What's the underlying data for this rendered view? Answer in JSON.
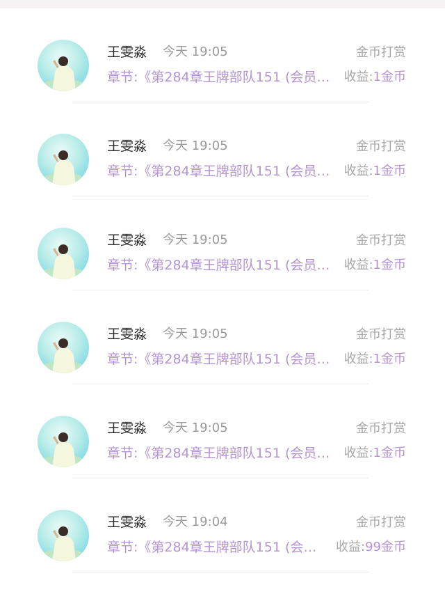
{
  "records": [
    {
      "name": "王雯淼",
      "time": "今天 19:05",
      "type": "金币打赏",
      "chapter": "章节:《第284章王牌部队151 (会员…",
      "income_label": "收益:",
      "income_value": "1金币"
    },
    {
      "name": "王雯淼",
      "time": "今天 19:05",
      "type": "金币打赏",
      "chapter": "章节:《第284章王牌部队151 (会员…",
      "income_label": "收益:",
      "income_value": "1金币"
    },
    {
      "name": "王雯淼",
      "time": "今天 19:05",
      "type": "金币打赏",
      "chapter": "章节:《第284章王牌部队151 (会员…",
      "income_label": "收益:",
      "income_value": "1金币"
    },
    {
      "name": "王雯淼",
      "time": "今天 19:05",
      "type": "金币打赏",
      "chapter": "章节:《第284章王牌部队151 (会员…",
      "income_label": "收益:",
      "income_value": "1金币"
    },
    {
      "name": "王雯淼",
      "time": "今天 19:05",
      "type": "金币打赏",
      "chapter": "章节:《第284章王牌部队151 (会员…",
      "income_label": "收益:",
      "income_value": "1金币"
    },
    {
      "name": "王雯淼",
      "time": "今天 19:04",
      "type": "金币打赏",
      "chapter": "章节:《第284章王牌部队151 (会…",
      "income_label": "收益:",
      "income_value": "99金币"
    }
  ],
  "colors": {
    "chapter_text": "#b493d2",
    "income_value": "#b493d2",
    "muted_text": "#a8a8a8",
    "name_text": "#2a2a2a"
  },
  "icons": {
    "avatar": "user-avatar-image"
  }
}
